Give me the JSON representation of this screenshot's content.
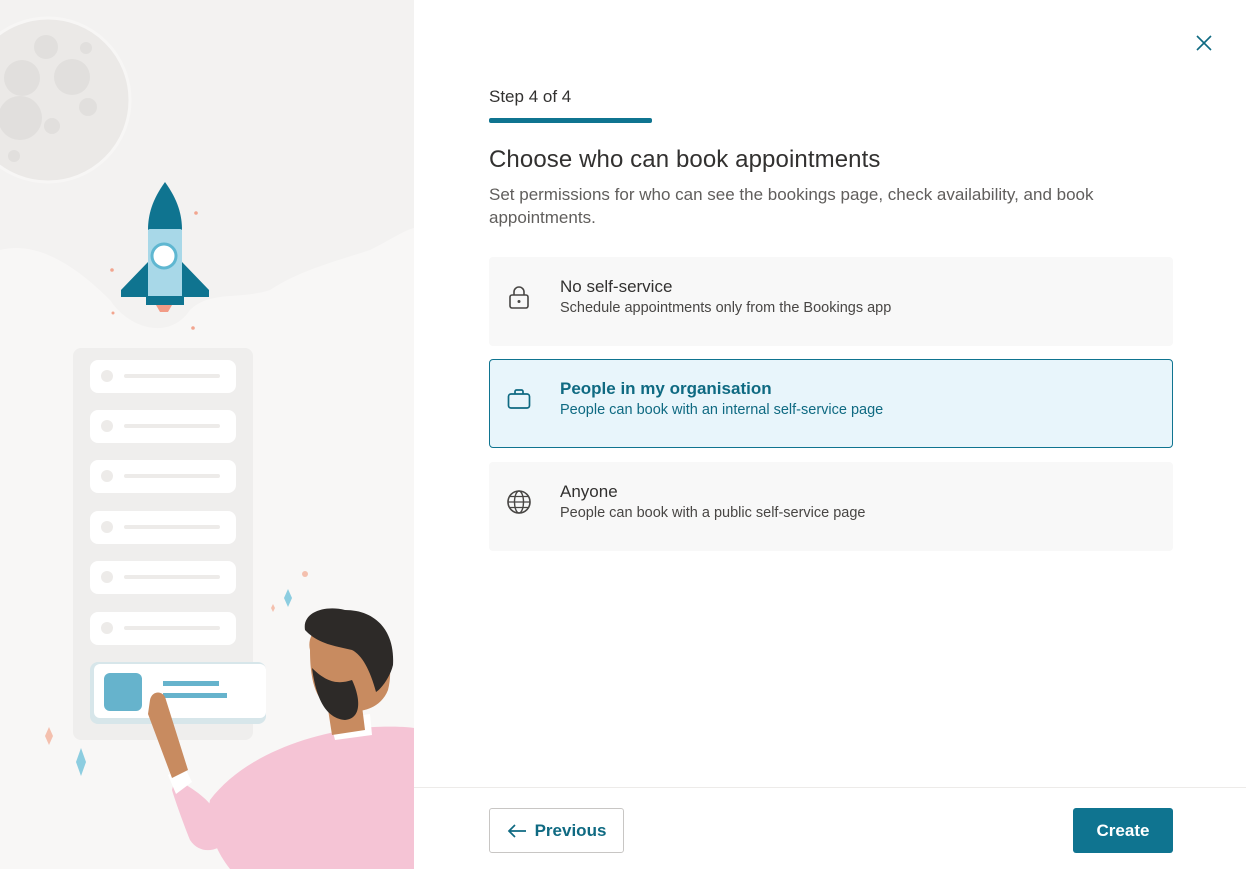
{
  "wizard": {
    "step_label": "Step 4 of 4",
    "progress": 1.0,
    "title": "Choose who can book appointments",
    "subtitle": "Set permissions for who can see the bookings page, check availability, and book appointments."
  },
  "options": [
    {
      "title": "No self-service",
      "description": "Schedule appointments only from the Bookings app",
      "icon": "lock-icon",
      "selected": false
    },
    {
      "title": "People in my organisation",
      "description": "People can book with an internal self-service page",
      "icon": "briefcase-icon",
      "selected": true
    },
    {
      "title": "Anyone",
      "description": "People can book with a public self-service page",
      "icon": "globe-icon",
      "selected": false
    }
  ],
  "footer": {
    "previous_label": "Previous",
    "create_label": "Create"
  },
  "colors": {
    "accent": "#0f7490",
    "selected_bg": "#e8f5fb"
  }
}
